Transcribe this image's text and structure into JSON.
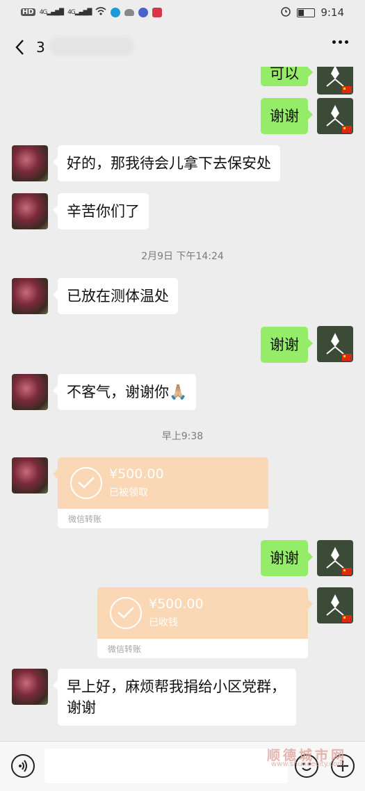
{
  "status_bar": {
    "left_items": [
      "HD",
      "4G",
      "4G"
    ],
    "time": "9:14",
    "battery_level": 0.3
  },
  "title_bar": {
    "title": "3"
  },
  "messages": [
    {
      "type": "text",
      "side": "out",
      "text": "可以"
    },
    {
      "type": "text",
      "side": "out",
      "text": "谢谢"
    },
    {
      "type": "text",
      "side": "in",
      "text": "好的，那我待会儿拿下去保安处"
    },
    {
      "type": "text",
      "side": "in",
      "text": "辛苦你们了"
    },
    {
      "type": "time",
      "text": "2月9日 下午14:24"
    },
    {
      "type": "text",
      "side": "in",
      "text": "已放在测体温处"
    },
    {
      "type": "text",
      "side": "out",
      "text": "谢谢"
    },
    {
      "type": "text",
      "side": "in",
      "text": "不客气，谢谢你🙏🏼"
    },
    {
      "type": "time",
      "text": "早上9:38"
    },
    {
      "type": "transfer",
      "side": "in",
      "amount": "¥500.00",
      "status": "已被领取",
      "label": "微信转账"
    },
    {
      "type": "text",
      "side": "out",
      "text": "谢谢"
    },
    {
      "type": "transfer",
      "side": "out",
      "amount": "¥500.00",
      "status": "已收钱",
      "label": "微信转账"
    },
    {
      "type": "text",
      "side": "in",
      "text": "早上好，麻烦帮我捐给小区党群，\n谢谢"
    }
  ],
  "watermark": {
    "name": "顺德城市网",
    "url": "www.shundecity.com"
  },
  "colors": {
    "background": "#ededed",
    "bubble_out": "#95ec69",
    "bubble_in": "#ffffff",
    "transfer": "#fad7b5"
  }
}
